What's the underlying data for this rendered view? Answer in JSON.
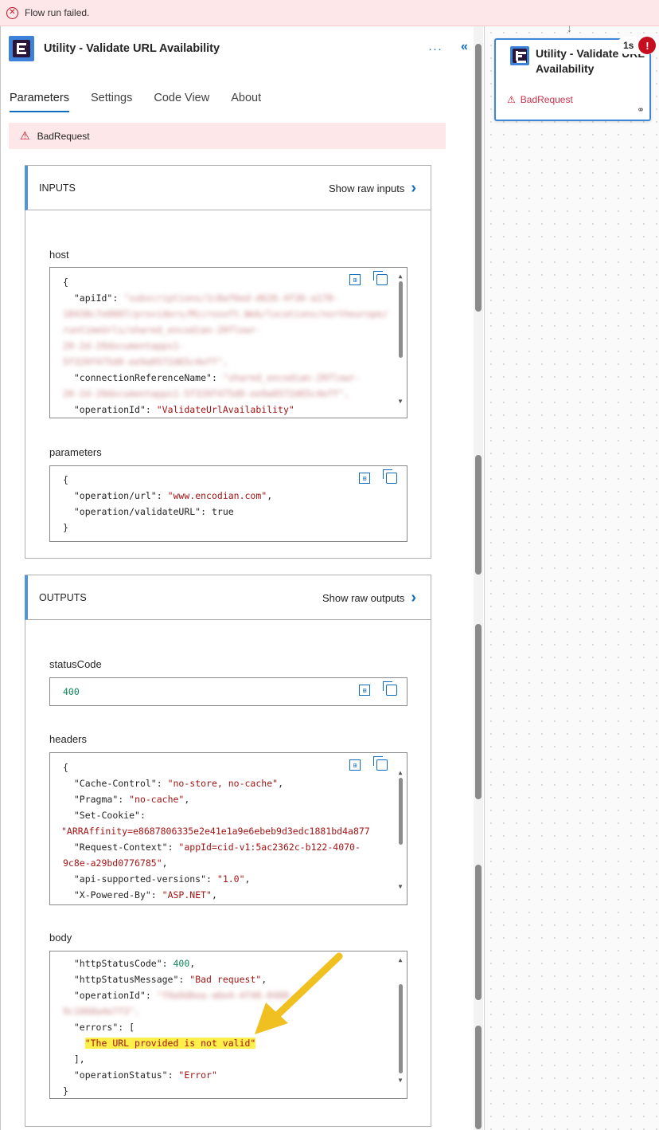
{
  "banner": {
    "message": "Flow run failed."
  },
  "panel": {
    "title": "Utility - Validate URL Availability",
    "more": "···",
    "collapse": "«",
    "tabs": [
      "Parameters",
      "Settings",
      "Code View",
      "About"
    ],
    "error": "BadRequest"
  },
  "inputs": {
    "title": "INPUTS",
    "raw_link": "Show raw inputs",
    "host_label": "host",
    "host": {
      "brace": "{",
      "apiId_key": "\"apiId\"",
      "apiId_blur1": "\"subscriptions/1c8af6ed-d626-4f36-a178-",
      "apiId_blur2": "18438c7e0007/providers/Microsoft.Web/locations/northeurope/",
      "apiId_blur3": "runtimeUrls/shared_encodian-20flowr-",
      "apiId_blur4": "20-2d-20documentapps1-",
      "apiId_blur5": "5f320f475d0-ee9a0572d65c4eff\",",
      "connRef_key": "\"connectionReferenceName\"",
      "connRef_blur1": "\"shared_encodian-20flowr-",
      "connRef_blur2": "20-2d-20documentapps1-5f320f475d0-ee9a0572d65c4eff\",",
      "opId_key": "\"operationId\"",
      "opId_val": "\"ValidateUrlAvailability\""
    },
    "params_label": "parameters",
    "params": {
      "open": "{",
      "url_key": "\"operation/url\"",
      "url_val": "\"www.encodian.com\"",
      "validate_key": "\"operation/validateURL\"",
      "validate_val": "true",
      "close": "}"
    }
  },
  "outputs": {
    "title": "OUTPUTS",
    "raw_link": "Show raw outputs",
    "status_label": "statusCode",
    "status_val": "400",
    "headers_label": "headers",
    "headers": {
      "open": "{",
      "cache_key": "\"Cache-Control\"",
      "cache_val": "\"no-store, no-cache\"",
      "pragma_key": "\"Pragma\"",
      "pragma_val": "\"no-cache\"",
      "cookie_key": "\"Set-Cookie\"",
      "cookie_val": "\"ARRAffinity=e8687806335e2e41e1a9e6ebeb9d3edc1881bd4a877",
      "ctx_key": "\"Request-Context\"",
      "ctx_val1": "\"appId=cid-v1:5ac2362c-b122-4070-",
      "ctx_val2": "9c8e-a29bd0776785\"",
      "api_key": "\"api-supported-versions\"",
      "api_val": "\"1.0\"",
      "xpb_key": "\"X-Powered-By\"",
      "xpb_val": "\"ASP.NET\""
    },
    "body_label": "body",
    "body": {
      "code_key": "\"httpStatusCode\"",
      "code_val": "400",
      "msg_key": "\"httpStatusMessage\"",
      "msg_val": "\"Bad request\"",
      "opid_key": "\"operationId\"",
      "opid_blur1": "\"f0a9d6ea-a6e4-4f48-8488-",
      "opid_blur2": "9c1068a4e7f3\",",
      "errors_key": "\"errors\"",
      "errors_open": "[",
      "error_val": "\"The URL provided is not valid\"",
      "errors_close": "],",
      "status_key": "\"operationStatus\"",
      "status_val": "\"Error\"",
      "close": "}"
    }
  },
  "canvas": {
    "node_title": "Utility - Validate URL Availability",
    "node_status": "BadRequest",
    "duration": "1s",
    "alert": "!"
  },
  "colors": {
    "accent": "#0f6cbd",
    "error": "#c50f1f",
    "highlight": "#ffef4a",
    "arrow": "#f0c020"
  }
}
